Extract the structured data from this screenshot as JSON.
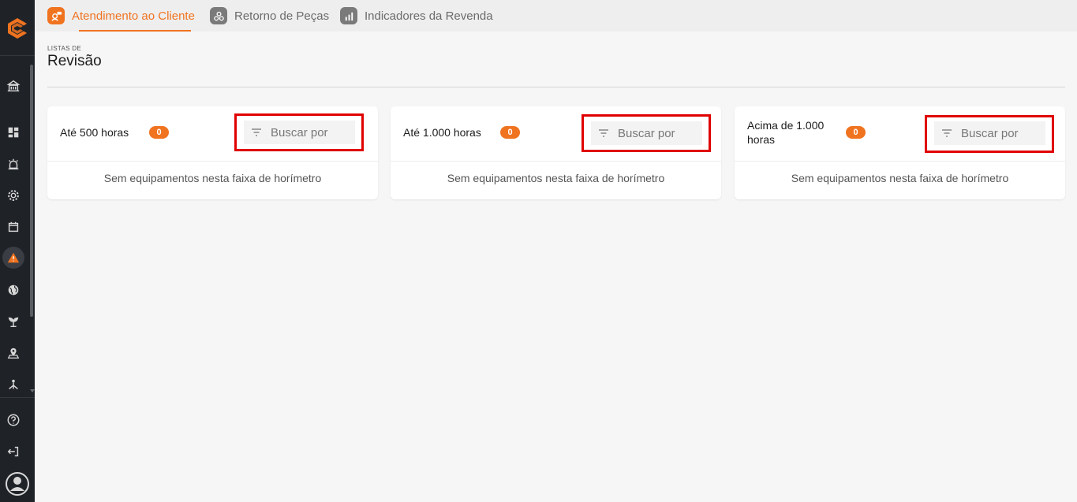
{
  "tabs": [
    {
      "label": "Atendimento ao Cliente",
      "active": true,
      "icon": "customer-service-icon"
    },
    {
      "label": "Retorno de Peças",
      "active": false,
      "icon": "parts-return-icon"
    },
    {
      "label": "Indicadores da Revenda",
      "active": false,
      "icon": "bar-chart-icon"
    }
  ],
  "header": {
    "pre": "LISTAS DE",
    "title": "Revisão"
  },
  "cards": [
    {
      "title": "Até 500 horas",
      "count": "0",
      "search_placeholder": "Buscar por",
      "empty": "Sem equipamentos nesta faixa de horímetro"
    },
    {
      "title": "Até 1.000 horas",
      "count": "0",
      "search_placeholder": "Buscar por",
      "empty": "Sem equipamentos nesta faixa de horímetro"
    },
    {
      "title_line1": "Acima de 1.000",
      "title_line2": "horas",
      "count": "0",
      "search_placeholder": "Buscar por",
      "empty": "Sem equipamentos nesta faixa de horímetro"
    }
  ],
  "colors": {
    "accent": "#f07320",
    "sidebar": "#1f2328",
    "highlight": "#e00000"
  }
}
